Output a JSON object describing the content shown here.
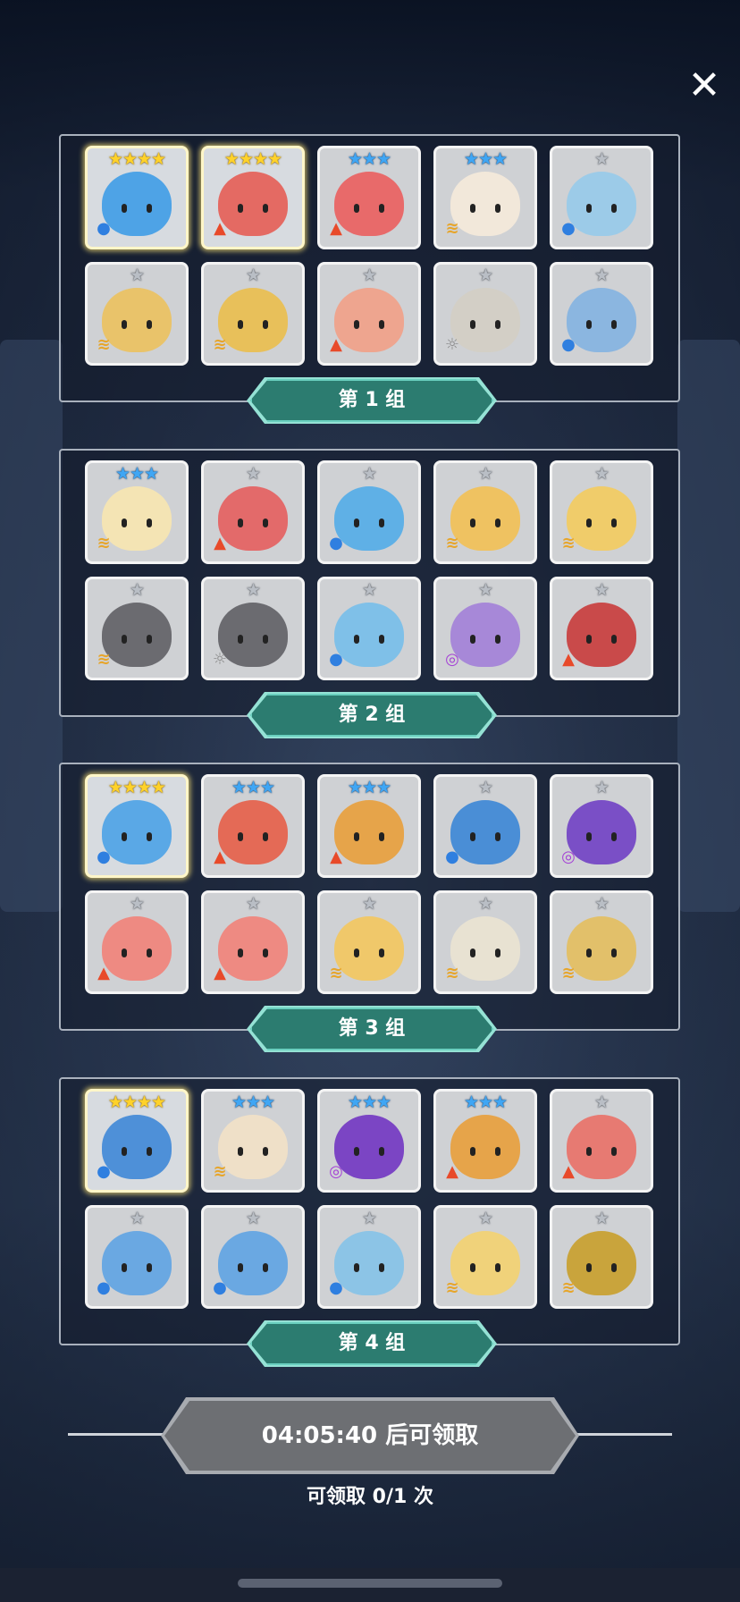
{
  "close_icon": "close-icon",
  "groups": [
    {
      "label": "第 1 组",
      "cards": [
        {
          "stars": 4,
          "tier": "gold",
          "element": "water",
          "color": "#4ea3e6"
        },
        {
          "stars": 4,
          "tier": "gold",
          "element": "fire",
          "color": "#e46a63"
        },
        {
          "stars": 3,
          "tier": "blue",
          "element": "fire",
          "color": "#e86a6a"
        },
        {
          "stars": 3,
          "tier": "blue",
          "element": "wind",
          "color": "#f2e8da"
        },
        {
          "stars": 1,
          "tier": "gray",
          "element": "water",
          "color": "#9ccbe8"
        },
        {
          "stars": 1,
          "tier": "gray",
          "element": "wind",
          "color": "#e9c36a"
        },
        {
          "stars": 1,
          "tier": "gray",
          "element": "wind",
          "color": "#e8c05a"
        },
        {
          "stars": 1,
          "tier": "gray",
          "element": "fire",
          "color": "#eea58f"
        },
        {
          "stars": 1,
          "tier": "gray",
          "element": "light",
          "color": "#d3cfc6"
        },
        {
          "stars": 1,
          "tier": "gray",
          "element": "water",
          "color": "#8bb6e0"
        }
      ]
    },
    {
      "label": "第 2 组",
      "cards": [
        {
          "stars": 3,
          "tier": "blue",
          "element": "wind",
          "color": "#f4e4b4"
        },
        {
          "stars": 1,
          "tier": "gray",
          "element": "fire",
          "color": "#e36a6a"
        },
        {
          "stars": 1,
          "tier": "gray",
          "element": "water",
          "color": "#5fb0e6"
        },
        {
          "stars": 1,
          "tier": "gray",
          "element": "wind",
          "color": "#efc261"
        },
        {
          "stars": 1,
          "tier": "gray",
          "element": "wind",
          "color": "#f0cc6a"
        },
        {
          "stars": 1,
          "tier": "gray",
          "element": "wind",
          "color": "#6b6b70"
        },
        {
          "stars": 1,
          "tier": "gray",
          "element": "light",
          "color": "#6b6b70"
        },
        {
          "stars": 1,
          "tier": "gray",
          "element": "water",
          "color": "#7fc0e8"
        },
        {
          "stars": 1,
          "tier": "gray",
          "element": "dark",
          "color": "#a788d8"
        },
        {
          "stars": 1,
          "tier": "gray",
          "element": "fire",
          "color": "#c94a4a"
        }
      ]
    },
    {
      "label": "第 3 组",
      "cards": [
        {
          "stars": 4,
          "tier": "gold",
          "element": "water",
          "color": "#5aa8e6"
        },
        {
          "stars": 3,
          "tier": "blue",
          "element": "fire",
          "color": "#e46a56"
        },
        {
          "stars": 3,
          "tier": "blue",
          "element": "fire",
          "color": "#e6a44a"
        },
        {
          "stars": 1,
          "tier": "gray",
          "element": "water",
          "color": "#4a8ed6"
        },
        {
          "stars": 1,
          "tier": "gray",
          "element": "dark",
          "color": "#7a4fc6"
        },
        {
          "stars": 1,
          "tier": "gray",
          "element": "fire",
          "color": "#ee8a82"
        },
        {
          "stars": 1,
          "tier": "gray",
          "element": "fire",
          "color": "#ee8a82"
        },
        {
          "stars": 1,
          "tier": "gray",
          "element": "wind",
          "color": "#f0c86a"
        },
        {
          "stars": 1,
          "tier": "gray",
          "element": "wind",
          "color": "#e8e2d2"
        },
        {
          "stars": 1,
          "tier": "gray",
          "element": "wind",
          "color": "#e2c06a"
        }
      ]
    },
    {
      "label": "第 4 组",
      "cards": [
        {
          "stars": 4,
          "tier": "gold",
          "element": "water",
          "color": "#4e90d8"
        },
        {
          "stars": 3,
          "tier": "blue",
          "element": "wind",
          "color": "#efe0c8"
        },
        {
          "stars": 3,
          "tier": "blue",
          "element": "dark",
          "color": "#7b45c4"
        },
        {
          "stars": 3,
          "tier": "blue",
          "element": "fire",
          "color": "#e6a44a"
        },
        {
          "stars": 1,
          "tier": "gray",
          "element": "fire",
          "color": "#e77a72"
        },
        {
          "stars": 1,
          "tier": "gray",
          "element": "water",
          "color": "#6aa8e2"
        },
        {
          "stars": 1,
          "tier": "gray",
          "element": "water",
          "color": "#6aa8e2"
        },
        {
          "stars": 1,
          "tier": "gray",
          "element": "water",
          "color": "#8cc4e6"
        },
        {
          "stars": 1,
          "tier": "gray",
          "element": "wind",
          "color": "#f0d27a"
        },
        {
          "stars": 1,
          "tier": "gray",
          "element": "wind",
          "color": "#c9a43c"
        }
      ]
    }
  ],
  "claim_button_label": "04:05:40 后可领取",
  "claim_count_text": "可领取 0/1 次",
  "colors": {
    "banner": "#2c7c70",
    "claim_button": "#6d6f73"
  }
}
